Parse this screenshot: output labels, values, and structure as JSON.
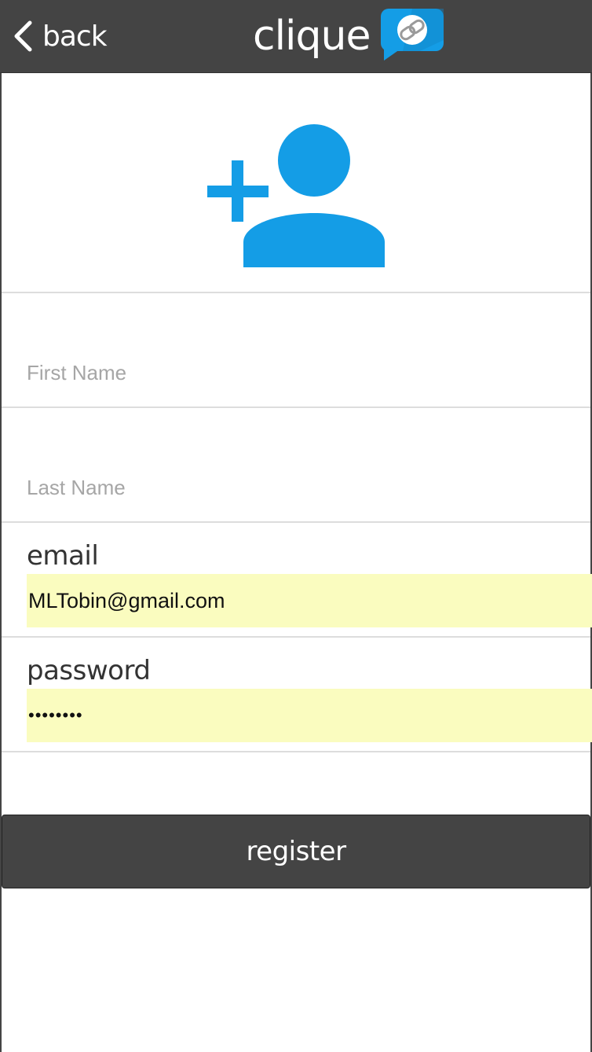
{
  "header": {
    "back_label": "back",
    "brand_name": "clique",
    "back_icon": "chevron-left-icon",
    "logo_icon": "chat-bubble-link-icon",
    "bar_color": "#444444",
    "accent_color": "#149de6"
  },
  "avatar": {
    "icon": "add-user-icon"
  },
  "form": {
    "first_name": {
      "placeholder": "First Name",
      "value": ""
    },
    "last_name": {
      "placeholder": "Last Name",
      "value": ""
    },
    "email": {
      "label": "email",
      "value": "MLTobin@gmail.com"
    },
    "password": {
      "label": "password",
      "value": "••••••••"
    },
    "autofill_color": "#fafcbf"
  },
  "actions": {
    "register_label": "register"
  }
}
